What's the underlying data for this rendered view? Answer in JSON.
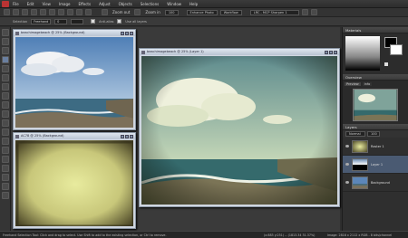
{
  "menu": {
    "items": [
      "File",
      "Edit",
      "View",
      "Image",
      "Effects",
      "Adjust",
      "Objects",
      "Selections",
      "Window",
      "Help"
    ]
  },
  "toolbar": {
    "zoom_out_label": "Zoom out",
    "zoom_in_label": "Zoom in",
    "zoom_value": "100",
    "preset_1": "Enhance Photo",
    "preset_2": "Workflow",
    "script_value": "LRC - MCP Sharpen 1"
  },
  "options": {
    "mode_label": "Selection",
    "type_value": "Freehand",
    "feather_value": "0",
    "antialias_label": "Anti-alias",
    "sample_label": "Use all layers"
  },
  "windows": {
    "beach1_title": "beachimagebeach @ 25% (Background)",
    "beach2_title": "beachimagebeach @ 25% (Layer 1)",
    "texture_title": "AC78 @ 25% (Background)"
  },
  "panels": {
    "materials_title": "Materials",
    "overview_title": "Overview",
    "overview_preview": "Preview",
    "overview_info": "Info",
    "layers_title": "Layers",
    "blend_value": "Normal",
    "opacity_value": "100",
    "layers": [
      {
        "name": "Raster 1"
      },
      {
        "name": "Layer 1"
      },
      {
        "name": "Background"
      }
    ]
  },
  "status": {
    "hint": "Freehand Selection Tool: Click and drag to select. Use Shift to add to the existing selection, or Ctrl to remove.",
    "coords": "(x:883 y:251) -- (1813.34 31.37%)",
    "image_info": "Image: 2816 x 2112 x RGB - 8 bits/channel"
  },
  "colors": {
    "sky_top": "#5c86b8",
    "sand": "#8a7a5e",
    "vintage_edge": "#4f4a2a",
    "vintage_center": "#e9ec9c",
    "sea": "#2f6470"
  }
}
